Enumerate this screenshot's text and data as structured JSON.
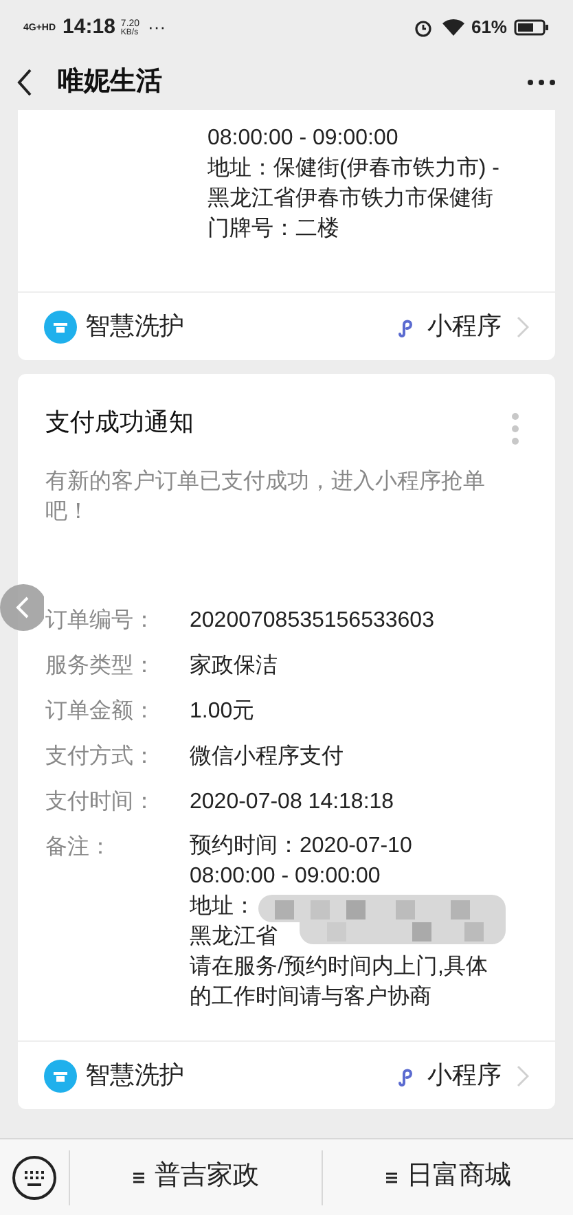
{
  "status_bar": {
    "network": "4G+HD",
    "time": "14:18",
    "speed": "7.20",
    "speed_unit": "KB/s",
    "more": "···",
    "battery": "61%"
  },
  "header": {
    "title": "唯妮生活"
  },
  "messages": [
    {
      "kind": "continued",
      "remark_lines": [
        {
          "text": "08:00:00 - 09:00:00"
        },
        {
          "text": "地址：保健街(伊春市铁力市) -"
        },
        {
          "text": "黑龙江省伊春市铁力市保健街"
        },
        {
          "text": "门牌号：二楼"
        }
      ],
      "source": "智慧洗护",
      "link": "小程序"
    },
    {
      "kind": "full",
      "title": "支付成功通知",
      "description": "有新的客户订单已支付成功，进入小程序抢单吧！",
      "fields": [
        {
          "label": "订单编号：",
          "value": "20200708535156533603"
        },
        {
          "label": "服务类型：",
          "value": "家政保洁"
        },
        {
          "label": "订单金额：",
          "value": "1.00元"
        },
        {
          "label": "支付方式：",
          "value": "微信小程序支付"
        },
        {
          "label": "支付时间：",
          "value": "2020-07-08 14:18:18"
        }
      ],
      "remark_label": "备注：",
      "remark_lines": [
        {
          "text": "预约时间：2020-07-10"
        },
        {
          "text": "08:00:00 - 09:00:00"
        },
        {
          "text": "地址：",
          "redacted": true
        },
        {
          "text": "黑龙江省",
          "redacted": true
        },
        {
          "text": "请在服务/预约时间内上门,具体"
        },
        {
          "text": "的工作时间请与客户协商"
        }
      ],
      "source": "智慧洗护",
      "link": "小程序"
    }
  ],
  "bottom_menu": [
    {
      "label": "普吉家政"
    },
    {
      "label": "日富商城"
    }
  ]
}
